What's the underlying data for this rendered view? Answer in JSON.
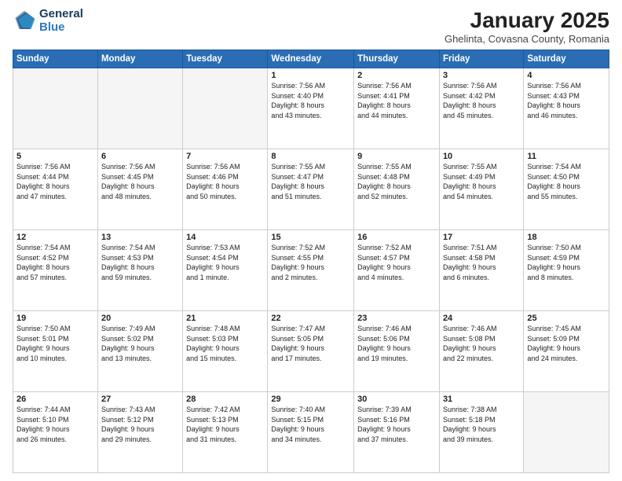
{
  "logo": {
    "line1": "General",
    "line2": "Blue"
  },
  "title": "January 2025",
  "subtitle": "Ghelinta, Covasna County, Romania",
  "days_of_week": [
    "Sunday",
    "Monday",
    "Tuesday",
    "Wednesday",
    "Thursday",
    "Friday",
    "Saturday"
  ],
  "weeks": [
    [
      {
        "day": "",
        "info": ""
      },
      {
        "day": "",
        "info": ""
      },
      {
        "day": "",
        "info": ""
      },
      {
        "day": "1",
        "info": "Sunrise: 7:56 AM\nSunset: 4:40 PM\nDaylight: 8 hours\nand 43 minutes."
      },
      {
        "day": "2",
        "info": "Sunrise: 7:56 AM\nSunset: 4:41 PM\nDaylight: 8 hours\nand 44 minutes."
      },
      {
        "day": "3",
        "info": "Sunrise: 7:56 AM\nSunset: 4:42 PM\nDaylight: 8 hours\nand 45 minutes."
      },
      {
        "day": "4",
        "info": "Sunrise: 7:56 AM\nSunset: 4:43 PM\nDaylight: 8 hours\nand 46 minutes."
      }
    ],
    [
      {
        "day": "5",
        "info": "Sunrise: 7:56 AM\nSunset: 4:44 PM\nDaylight: 8 hours\nand 47 minutes."
      },
      {
        "day": "6",
        "info": "Sunrise: 7:56 AM\nSunset: 4:45 PM\nDaylight: 8 hours\nand 48 minutes."
      },
      {
        "day": "7",
        "info": "Sunrise: 7:56 AM\nSunset: 4:46 PM\nDaylight: 8 hours\nand 50 minutes."
      },
      {
        "day": "8",
        "info": "Sunrise: 7:55 AM\nSunset: 4:47 PM\nDaylight: 8 hours\nand 51 minutes."
      },
      {
        "day": "9",
        "info": "Sunrise: 7:55 AM\nSunset: 4:48 PM\nDaylight: 8 hours\nand 52 minutes."
      },
      {
        "day": "10",
        "info": "Sunrise: 7:55 AM\nSunset: 4:49 PM\nDaylight: 8 hours\nand 54 minutes."
      },
      {
        "day": "11",
        "info": "Sunrise: 7:54 AM\nSunset: 4:50 PM\nDaylight: 8 hours\nand 55 minutes."
      }
    ],
    [
      {
        "day": "12",
        "info": "Sunrise: 7:54 AM\nSunset: 4:52 PM\nDaylight: 8 hours\nand 57 minutes."
      },
      {
        "day": "13",
        "info": "Sunrise: 7:54 AM\nSunset: 4:53 PM\nDaylight: 8 hours\nand 59 minutes."
      },
      {
        "day": "14",
        "info": "Sunrise: 7:53 AM\nSunset: 4:54 PM\nDaylight: 9 hours\nand 1 minute."
      },
      {
        "day": "15",
        "info": "Sunrise: 7:52 AM\nSunset: 4:55 PM\nDaylight: 9 hours\nand 2 minutes."
      },
      {
        "day": "16",
        "info": "Sunrise: 7:52 AM\nSunset: 4:57 PM\nDaylight: 9 hours\nand 4 minutes."
      },
      {
        "day": "17",
        "info": "Sunrise: 7:51 AM\nSunset: 4:58 PM\nDaylight: 9 hours\nand 6 minutes."
      },
      {
        "day": "18",
        "info": "Sunrise: 7:50 AM\nSunset: 4:59 PM\nDaylight: 9 hours\nand 8 minutes."
      }
    ],
    [
      {
        "day": "19",
        "info": "Sunrise: 7:50 AM\nSunset: 5:01 PM\nDaylight: 9 hours\nand 10 minutes."
      },
      {
        "day": "20",
        "info": "Sunrise: 7:49 AM\nSunset: 5:02 PM\nDaylight: 9 hours\nand 13 minutes."
      },
      {
        "day": "21",
        "info": "Sunrise: 7:48 AM\nSunset: 5:03 PM\nDaylight: 9 hours\nand 15 minutes."
      },
      {
        "day": "22",
        "info": "Sunrise: 7:47 AM\nSunset: 5:05 PM\nDaylight: 9 hours\nand 17 minutes."
      },
      {
        "day": "23",
        "info": "Sunrise: 7:46 AM\nSunset: 5:06 PM\nDaylight: 9 hours\nand 19 minutes."
      },
      {
        "day": "24",
        "info": "Sunrise: 7:46 AM\nSunset: 5:08 PM\nDaylight: 9 hours\nand 22 minutes."
      },
      {
        "day": "25",
        "info": "Sunrise: 7:45 AM\nSunset: 5:09 PM\nDaylight: 9 hours\nand 24 minutes."
      }
    ],
    [
      {
        "day": "26",
        "info": "Sunrise: 7:44 AM\nSunset: 5:10 PM\nDaylight: 9 hours\nand 26 minutes."
      },
      {
        "day": "27",
        "info": "Sunrise: 7:43 AM\nSunset: 5:12 PM\nDaylight: 9 hours\nand 29 minutes."
      },
      {
        "day": "28",
        "info": "Sunrise: 7:42 AM\nSunset: 5:13 PM\nDaylight: 9 hours\nand 31 minutes."
      },
      {
        "day": "29",
        "info": "Sunrise: 7:40 AM\nSunset: 5:15 PM\nDaylight: 9 hours\nand 34 minutes."
      },
      {
        "day": "30",
        "info": "Sunrise: 7:39 AM\nSunset: 5:16 PM\nDaylight: 9 hours\nand 37 minutes."
      },
      {
        "day": "31",
        "info": "Sunrise: 7:38 AM\nSunset: 5:18 PM\nDaylight: 9 hours\nand 39 minutes."
      },
      {
        "day": "",
        "info": ""
      }
    ]
  ]
}
